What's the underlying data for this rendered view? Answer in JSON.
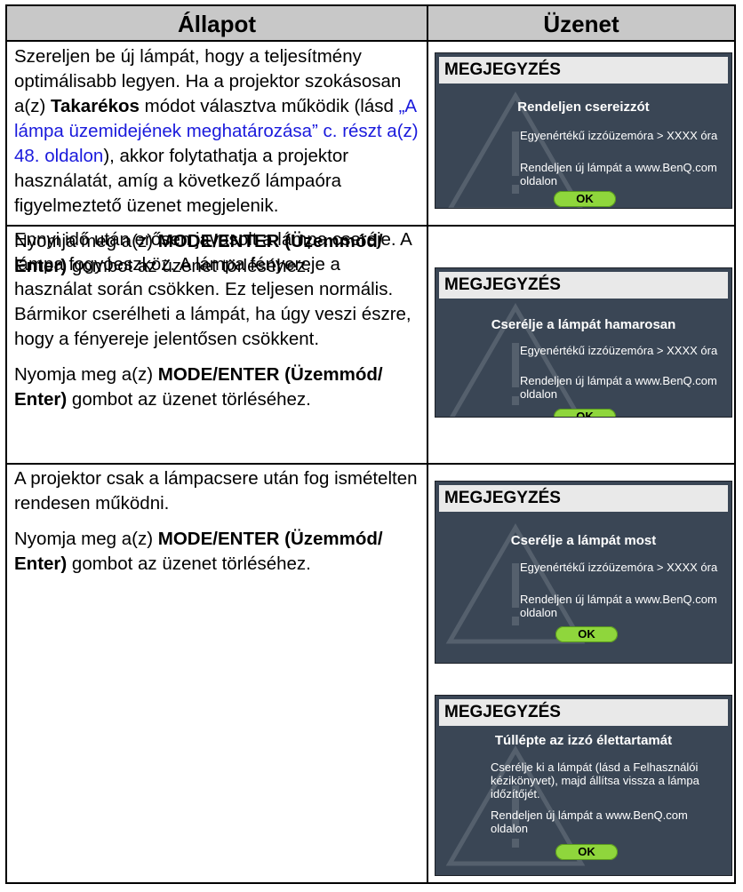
{
  "header": {
    "col_state": "Állapot",
    "col_message": "Üzenet"
  },
  "rows": [
    {
      "p1_before": "Szereljen be új lámpát, hogy a teljesítmény optimálisabb legyen. Ha a projektor szokásosan a(z) ",
      "p1_bold": "Takarékos",
      "p1_mid": " módot választva működik (lásd ",
      "p1_link": "„A lámpa üzemidejének meghatározása” c. részt a(z) 48. oldalon",
      "p1_after": "), akkor folytathatja a projektor használatát, amíg a következő lámpaóra figyelmeztető üzenet megjelenik.",
      "p2_before": "Nyomja meg a(z) ",
      "p2_bold": "MODE/ENTER (Üzemmód/ Enter)",
      "p2_after": " gombot az üzenet törléséhez."
    },
    {
      "p1": "Ennyi idő után erősen javasolt a lámpa cseréje. A lámpa fogyóeszköz. A lámpa fényereje a használat során csökken. Ez teljesen normális. Bármikor cserélheti a lámpát, ha úgy veszi észre, hogy a fényereje jelentősen csökkent.",
      "p2_before": "Nyomja meg a(z) ",
      "p2_bold": "MODE/ENTER (Üzemmód/ Enter)",
      "p2_after": " gombot az üzenet törléséhez."
    },
    {
      "p1": "A projektor csak a lámpacsere után fog ismételten rendesen működni.",
      "p2_before": "Nyomja meg a(z) ",
      "p2_bold": "MODE/ENTER (Üzemmód/ Enter)",
      "p2_after": " gombot az üzenet törléséhez."
    }
  ],
  "messages": [
    {
      "title": "MEGJEGYZÉS",
      "heading": "Rendeljen csereizzót",
      "line1": "Egyenértékű izzóüzemóra > XXXX óra",
      "line2": "Rendeljen új lámpát a www.BenQ.com oldalon",
      "ok": "OK"
    },
    {
      "title": "MEGJEGYZÉS",
      "heading": "Cserélje a lámpát hamarosan",
      "line1": "Egyenértékű izzóüzemóra > XXXX óra",
      "line2": "Rendeljen új lámpát a www.BenQ.com oldalon",
      "ok": "OK"
    },
    {
      "title": "MEGJEGYZÉS",
      "heading": "Cserélje a lámpát most",
      "line1": "Egyenértékű izzóüzemóra > XXXX óra",
      "line2": "Rendeljen új lámpát a www.BenQ.com oldalon",
      "ok": "OK"
    },
    {
      "title": "MEGJEGYZÉS",
      "heading": "Túllépte az izzó élettartamát",
      "line1": "Cserélje ki a lámpát (lásd a Felhasználói kézikönyvet), majd állítsa vissza a lámpa időzítőjét.",
      "line2": "Rendeljen új lámpát a www.BenQ.com oldalon",
      "ok": "OK"
    }
  ],
  "colors": {
    "dialog_bg": "#3a4655",
    "ok_button": "#8fd63c",
    "link": "#1a1adc",
    "header_bg": "#c8c8c8"
  },
  "icons": {
    "dialog_background": "warning-triangle-icon"
  }
}
